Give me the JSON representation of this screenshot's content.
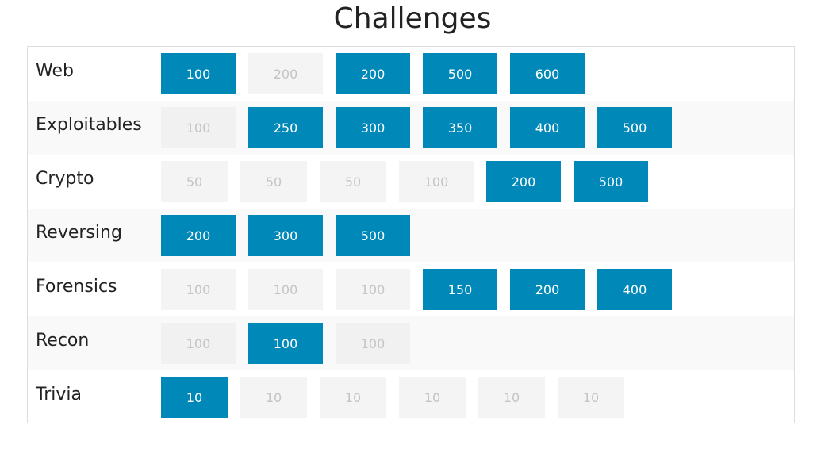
{
  "page": {
    "title": "Challenges"
  },
  "colors": {
    "unsolved_tile": "#0088b8",
    "solved_tile": "#f4f4f4",
    "solved_text": "#c4c4c4",
    "row_stripe": "#f9f9f9"
  },
  "categories": [
    {
      "name": "Web",
      "tiles": [
        {
          "points": "100",
          "solved": false
        },
        {
          "points": "200",
          "solved": true
        },
        {
          "points": "200",
          "solved": false
        },
        {
          "points": "500",
          "solved": false
        },
        {
          "points": "600",
          "solved": false
        }
      ]
    },
    {
      "name": "Exploitables",
      "tiles": [
        {
          "points": "100",
          "solved": true
        },
        {
          "points": "250",
          "solved": false
        },
        {
          "points": "300",
          "solved": false
        },
        {
          "points": "350",
          "solved": false
        },
        {
          "points": "400",
          "solved": false
        },
        {
          "points": "500",
          "solved": false
        }
      ]
    },
    {
      "name": "Crypto",
      "tiles": [
        {
          "points": "50",
          "solved": true
        },
        {
          "points": "50",
          "solved": true
        },
        {
          "points": "50",
          "solved": true
        },
        {
          "points": "100",
          "solved": true
        },
        {
          "points": "200",
          "solved": false
        },
        {
          "points": "500",
          "solved": false
        }
      ]
    },
    {
      "name": "Reversing",
      "tiles": [
        {
          "points": "200",
          "solved": false
        },
        {
          "points": "300",
          "solved": false
        },
        {
          "points": "500",
          "solved": false
        }
      ]
    },
    {
      "name": "Forensics",
      "tiles": [
        {
          "points": "100",
          "solved": true
        },
        {
          "points": "100",
          "solved": true
        },
        {
          "points": "100",
          "solved": true
        },
        {
          "points": "150",
          "solved": false
        },
        {
          "points": "200",
          "solved": false
        },
        {
          "points": "400",
          "solved": false
        }
      ]
    },
    {
      "name": "Recon",
      "tiles": [
        {
          "points": "100",
          "solved": true
        },
        {
          "points": "100",
          "solved": false
        },
        {
          "points": "100",
          "solved": true
        }
      ]
    },
    {
      "name": "Trivia",
      "tiles": [
        {
          "points": "10",
          "solved": false
        },
        {
          "points": "10",
          "solved": true
        },
        {
          "points": "10",
          "solved": true
        },
        {
          "points": "10",
          "solved": true
        },
        {
          "points": "10",
          "solved": true
        },
        {
          "points": "10",
          "solved": true
        }
      ]
    }
  ]
}
